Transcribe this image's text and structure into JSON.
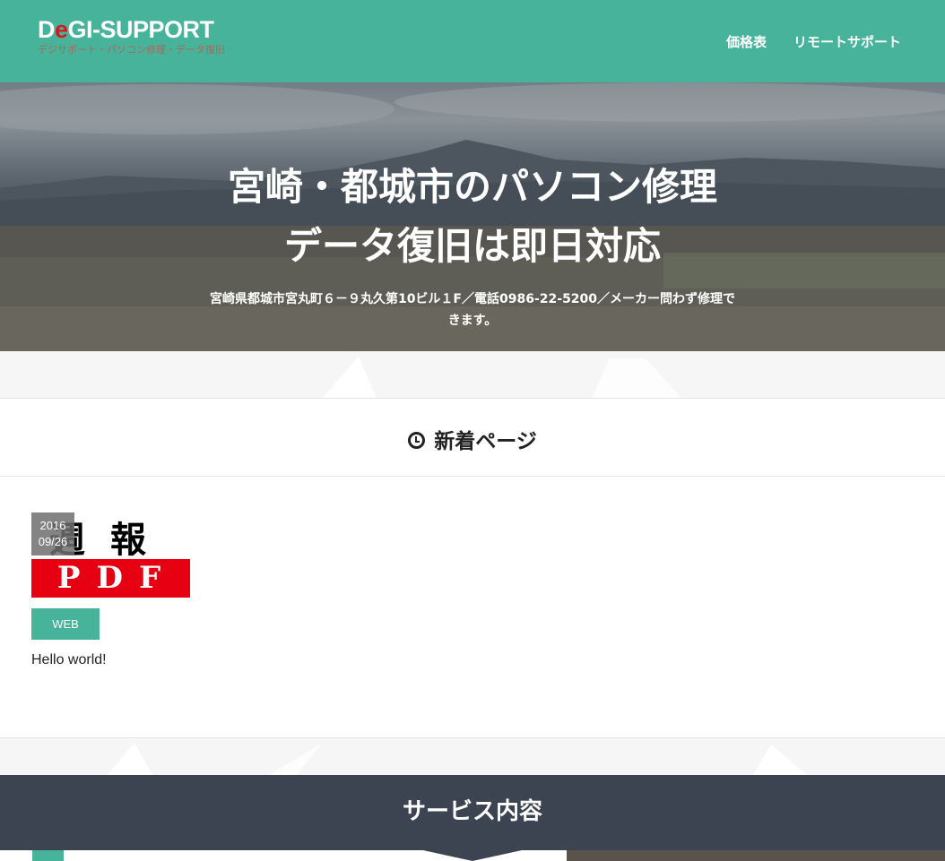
{
  "header": {
    "logo_prefix": "D",
    "logo_e": "e",
    "logo_rest": "GI-SUPPORT",
    "logo_sub": "デジサポート・パソコン修理・データ復旧",
    "nav": [
      {
        "label": "価格表"
      },
      {
        "label": "リモートサポート"
      }
    ]
  },
  "hero": {
    "title_line1": "宮崎・都城市のパソコン修理",
    "title_line2": "データ復旧は即日対応",
    "subtitle": "宮崎県都城市宮丸町６－９丸久第10ビル１F／電話0986-22-5200／メーカー問わず修理できます。"
  },
  "new_pages": {
    "heading": "新着ページ",
    "posts": [
      {
        "date_year": "2016",
        "date_md": "09/26",
        "thumb_text": "週報",
        "thumb_pdf": "PDF",
        "category": "WEB",
        "title": "Hello world!"
      }
    ]
  },
  "services": {
    "heading": "サービス内容"
  },
  "colors": {
    "brand_green": "#47b39a",
    "dark_band": "#3b4450",
    "pdf_red": "#e60012",
    "logo_red": "#d8171e"
  }
}
